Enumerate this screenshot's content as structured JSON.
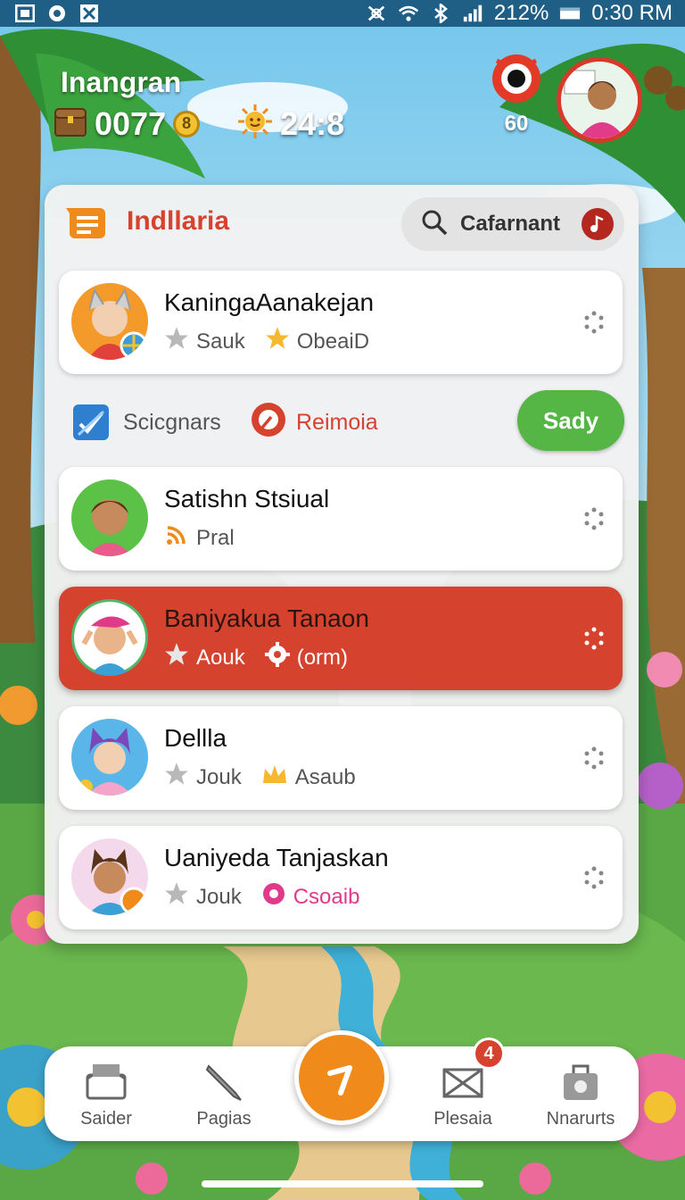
{
  "status_bar": {
    "battery_text": "212%",
    "time": "0:30 RM"
  },
  "header": {
    "player_name": "Inangran",
    "coins": "0077",
    "coin_symbol": "8",
    "energy": "24:8",
    "target_count": "60"
  },
  "panel": {
    "title": "Indllaria",
    "search_label": "Cafarnant",
    "filter": {
      "checkbox_label": "Scicgnars",
      "remind_label": "Reimoia",
      "ready_button": "Sady"
    },
    "players": [
      {
        "name": "KaningaAanakejan",
        "tag1": "Sauk",
        "tag2": "ObeaiD",
        "active": false
      },
      {
        "name": "Satishn Stsiual",
        "tag1": "Pral",
        "tag2": "",
        "active": false
      },
      {
        "name": "Baniyakua Tanaon",
        "tag1": "Aouk",
        "tag2": "(orm)",
        "active": true
      },
      {
        "name": "Dellla",
        "tag1": "Jouk",
        "tag2": "Asaub",
        "active": false
      },
      {
        "name": "Uaniyeda Tanjaskan",
        "tag1": "Jouk",
        "tag2": "Csoaib",
        "active": false
      }
    ]
  },
  "bottom_nav": {
    "items": [
      {
        "label": "Saider",
        "icon": "chest-icon"
      },
      {
        "label": "Pagias",
        "icon": "pencil-icon"
      },
      {
        "label": "Plesaia",
        "icon": "mail-icon"
      },
      {
        "label": "Nnarurts",
        "icon": "bag-icon"
      }
    ],
    "badge": "4"
  },
  "colors": {
    "accent": "#d5432f",
    "ready": "#55b545",
    "fab": "#f08a1a",
    "status_bar": "#1f5f86"
  }
}
